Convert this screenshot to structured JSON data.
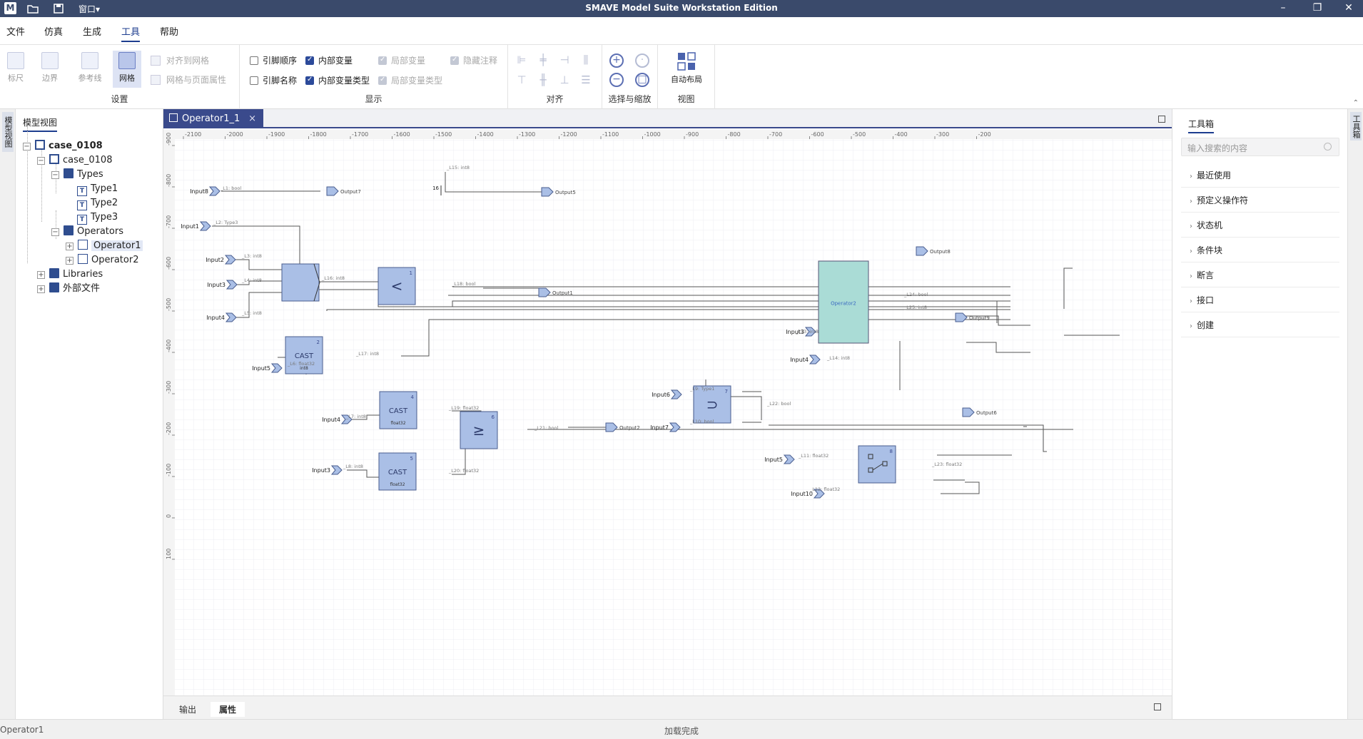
{
  "window": {
    "title": "SMAVE Model Suite Workstation Edition",
    "menu_window": "窗口▾",
    "minimize_glyph": "–",
    "restore_glyph": "❐",
    "close_glyph": "✕"
  },
  "menu": [
    "文件",
    "仿真",
    "生成",
    "工具",
    "帮助"
  ],
  "ribbon": {
    "settings": {
      "label": "设置",
      "ruler": "标尺",
      "border": "边界",
      "guides": "参考线",
      "grid": "网格",
      "align_to_grid": "对齐到网格",
      "grid_page_props": "网格与页面属性"
    },
    "display": {
      "label": "显示",
      "checks": [
        {
          "label": "引脚顺序",
          "checked": false,
          "disabled": false
        },
        {
          "label": "引脚名称",
          "checked": false,
          "disabled": false
        },
        {
          "label": "内部变量",
          "checked": true,
          "disabled": false
        },
        {
          "label": "内部变量类型",
          "checked": true,
          "disabled": false
        },
        {
          "label": "局部变量",
          "checked": true,
          "disabled": true
        },
        {
          "label": "局部变量类型",
          "checked": true,
          "disabled": true
        },
        {
          "label": "隐藏注释",
          "checked": true,
          "disabled": true
        }
      ]
    },
    "align": {
      "label": "对齐"
    },
    "zoom": {
      "label": "选择与缩放"
    },
    "view": {
      "label": "视图",
      "auto_layout": "自动布局"
    }
  },
  "side_tabs": {
    "left": "模型视图",
    "right": "工具箱"
  },
  "tree": {
    "panel_title": "模型视图",
    "nodes": [
      {
        "label": "case_0108",
        "bold": true
      },
      {
        "label": "case_0108"
      },
      {
        "label": "Types"
      },
      {
        "label": "Type1"
      },
      {
        "label": "Type2"
      },
      {
        "label": "Type3"
      },
      {
        "label": "Operators"
      },
      {
        "label": "Operator1"
      },
      {
        "label": "Operator2"
      },
      {
        "label": "Libraries"
      },
      {
        "label": "外部文件"
      }
    ]
  },
  "editor": {
    "tab": "Operator1_1",
    "tab_close": "×"
  },
  "bottom_tabs": [
    "输出",
    "属性"
  ],
  "toolbox": {
    "title": "工具箱",
    "search_placeholder": "输入搜索的内容",
    "categories": [
      "最近使用",
      "预定义操作符",
      "状态机",
      "条件块",
      "断言",
      "接口",
      "创建"
    ]
  },
  "status": {
    "left": "Operator1",
    "center": "加载完成"
  },
  "diagram": {
    "x_ticks": [
      "-2100",
      "-2000",
      "-1900",
      "-1800",
      "-1700",
      "-1600",
      "-1500",
      "-1400",
      "-1300",
      "-1200",
      "-1100",
      "-1000",
      "-900",
      "-800",
      "-700",
      "-600",
      "-500",
      "-400",
      "-300",
      "-200"
    ],
    "y_ticks": [
      "-900",
      "-800",
      "-700",
      "-600",
      "-500",
      "-400",
      "-300",
      "-200",
      "-100",
      "0",
      "100"
    ],
    "blocks": [
      {
        "id": "b1",
        "title": "",
        "num": ""
      },
      {
        "id": "b_lt",
        "title": "<",
        "num": "1"
      },
      {
        "id": "b_cast1",
        "title": "CAST",
        "num": "2",
        "sub": "int8"
      },
      {
        "id": "b_cast2",
        "title": "CAST",
        "num": "4",
        "sub": "float32"
      },
      {
        "id": "b_cast3",
        "title": "CAST",
        "num": "5",
        "sub": "float32"
      },
      {
        "id": "b_ge",
        "title": "≥",
        "num": "6"
      },
      {
        "id": "b_xor",
        "title": "⊃",
        "num": "7"
      },
      {
        "id": "b_sw",
        "title": "",
        "num": "8"
      },
      {
        "id": "b_op2",
        "title": "Operator2",
        "num": ""
      }
    ],
    "inputs": [
      "Input8",
      "Input1",
      "Input2",
      "Input3",
      "Input4",
      "Input5",
      "Input4",
      "Input3",
      "Input6",
      "Input7",
      "Input3",
      "Input4",
      "Input5",
      "Input10",
      "16"
    ],
    "outputs": [
      "Output7",
      "Output5",
      "Output1",
      "Output8",
      "Output9",
      "Output2",
      "Output6"
    ],
    "wire_labels": [
      "_L1: bool",
      "_L15: int8",
      "_L2: Type3",
      "_L3: int8",
      "_L4: int8",
      "_L5: int8",
      "_L16: int8",
      "_L18: bool",
      "_L6: float32",
      "_L17: int8",
      "_L7: int8",
      "_L19: float32",
      "_L8: int8",
      "_L20: float32",
      "_L21: bool",
      "_L9: Type1",
      "_L10: bool",
      "_L22: bool",
      "_L11: float32",
      "_L12: float32",
      "_L23: float32",
      "_L13: int8",
      "_L14: int8",
      "_L24: bool",
      "_L25: int8"
    ]
  }
}
